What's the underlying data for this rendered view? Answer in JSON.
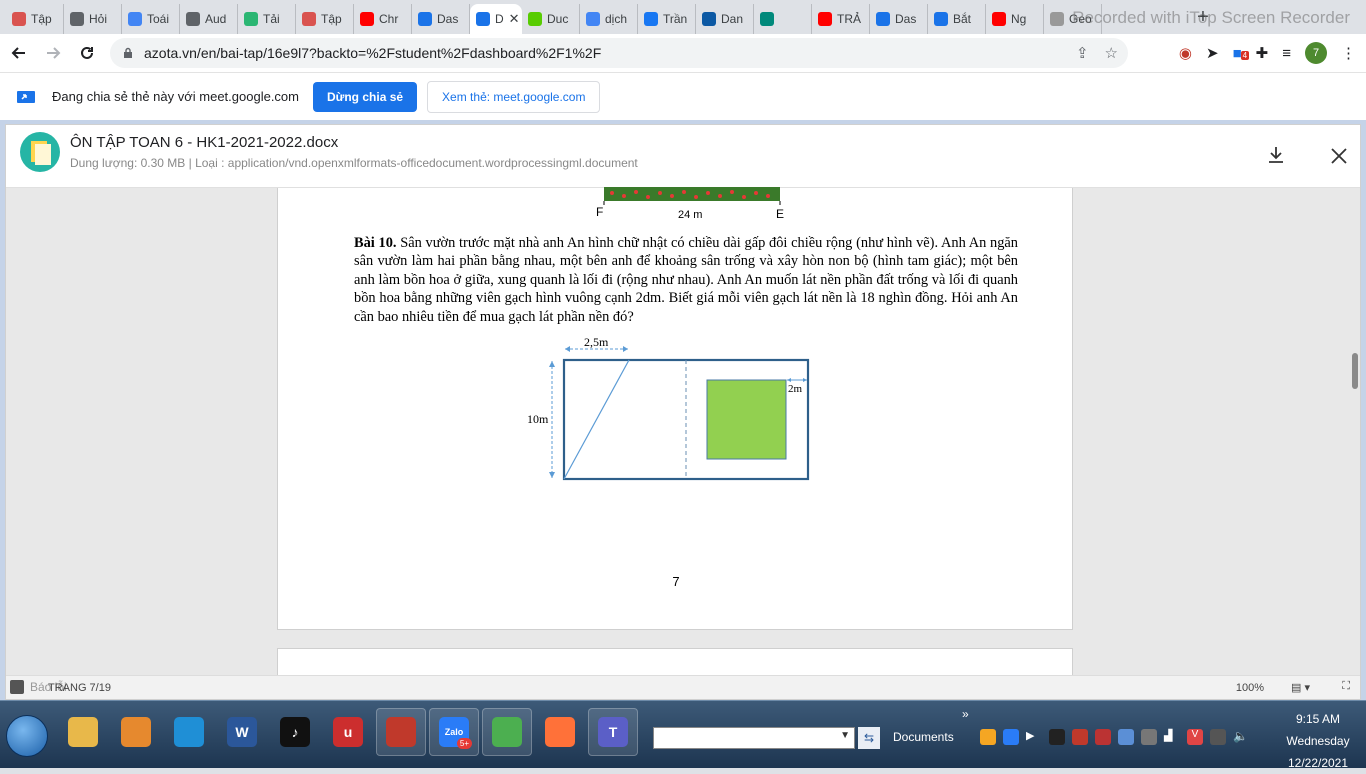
{
  "browser": {
    "tabs": [
      {
        "label": "Tập",
        "icon": "azota-icon",
        "color": "#d9534f"
      },
      {
        "label": "Hỏi",
        "icon": "globe-icon",
        "color": "#5f6368"
      },
      {
        "label": "Toái",
        "icon": "google-icon",
        "color": "#4285f4"
      },
      {
        "label": "Aud",
        "icon": "globe-icon",
        "color": "#5f6368"
      },
      {
        "label": "Tải",
        "icon": "music-icon",
        "color": "#2bb673"
      },
      {
        "label": "Tập",
        "icon": "azota-icon",
        "color": "#d9534f"
      },
      {
        "label": "Chr",
        "icon": "youtube-icon",
        "color": "#ff0000"
      },
      {
        "label": "Das",
        "icon": "drive-icon",
        "color": "#1a73e8"
      },
      {
        "label": "D",
        "icon": "document-icon",
        "color": "#1a73e8",
        "active": true
      },
      {
        "label": "Duc",
        "icon": "owl-icon",
        "color": "#58cc02"
      },
      {
        "label": "dịch",
        "icon": "google-icon",
        "color": "#4285f4"
      },
      {
        "label": "Trần",
        "icon": "facebook-icon",
        "color": "#1877f2"
      },
      {
        "label": "Dan",
        "icon": "edge-icon",
        "color": "#0c59a4"
      },
      {
        "label": "",
        "icon": "meet-icon",
        "color": "#00897b"
      },
      {
        "label": "TRẢ",
        "icon": "youtube-icon",
        "color": "#ff0000"
      },
      {
        "label": "Das",
        "icon": "drive-icon",
        "color": "#1a73e8"
      },
      {
        "label": "Bắt",
        "icon": "drive-icon",
        "color": "#1a73e8"
      },
      {
        "label": "Ng",
        "icon": "youtube-icon",
        "color": "#ff0000"
      },
      {
        "label": "Geo",
        "icon": "geogebra-icon",
        "color": "#999999"
      }
    ],
    "watermark": "Recorded with iTop Screen Recorder",
    "url": "azota.vn/en/bai-tap/16e9l7?backto=%2Fstudent%2Fdashboard%2F1%2F",
    "extension_badge": "4",
    "avatar_letter": "7"
  },
  "sharebar": {
    "text": "Đang chia sẻ thẻ này với meet.google.com",
    "stop_label": "Dừng chia sẻ",
    "view_label": "Xem thẻ: meet.google.com"
  },
  "document": {
    "title": "ÔN TẬP TOAN 6 - HK1-2021-2022.docx",
    "meta": "Dung lượng: 0.30 MB | Loại : application/vnd.openxmlformats-officedocument.wordprocessingml.document",
    "top_figure": {
      "label_f": "F",
      "label_e": "E",
      "length": "24 m"
    },
    "problem_title": "Bài 10.",
    "problem_text": "Sân vườn trước mặt nhà anh An hình chữ nhật có chiều dài gấp đôi chiều rộng (như hình vẽ). Anh An ngăn sân vườn làm hai phần bằng nhau, một bên anh để khoảng sân trống và xây hòn non bộ (hình tam giác); một bên anh làm bồn hoa ở giữa, xung quanh là lối đi (rộng như nhau). Anh An muốn lát nền phần đất trống và lối đi quanh bồn hoa bằng những viên gạch hình vuông cạnh 2dm. Biết giá mỗi viên gạch lát nền là 18 nghìn đồng. Hỏi anh An cần bao nhiêu tiền để mua gạch lát phần nền đó?",
    "figure": {
      "top_dim": "2,5m",
      "side_dim": "10m",
      "path_dim": "2m",
      "flowerbed_color": "#92d050",
      "frame_color": "#2e5f8a"
    },
    "page_number": "7",
    "status_page": "TRANG 7/19",
    "status_feedback": "Báo lỗi",
    "zoom": "100%"
  },
  "taskbar": {
    "apps": [
      {
        "name": "file-explorer",
        "color": "#e8b84a",
        "open": false
      },
      {
        "name": "media-player",
        "color": "#e6892e",
        "open": false
      },
      {
        "name": "edge",
        "color": "#1f8fd6",
        "open": false
      },
      {
        "name": "word",
        "color": "#2b579a",
        "open": false,
        "glyph": "W"
      },
      {
        "name": "tiktok",
        "color": "#111111",
        "open": false,
        "glyph": "♪"
      },
      {
        "name": "unikey",
        "color": "#cc2e2e",
        "open": false,
        "glyph": "u"
      },
      {
        "name": "screen-recorder",
        "color": "#c0392b",
        "open": true
      },
      {
        "name": "zalo",
        "color": "#2a7cf7",
        "open": true,
        "glyph": "Zalo"
      },
      {
        "name": "chrome",
        "color": "#4caf50",
        "open": true
      },
      {
        "name": "firefox",
        "color": "#ff7139",
        "open": false
      },
      {
        "name": "teams",
        "color": "#5b5fc7",
        "open": true,
        "glyph": "T"
      }
    ],
    "zalo_badge": "5+",
    "documents_label": "Documents",
    "time": "9:15 AM",
    "day": "Wednesday",
    "date": "12/22/2021"
  }
}
